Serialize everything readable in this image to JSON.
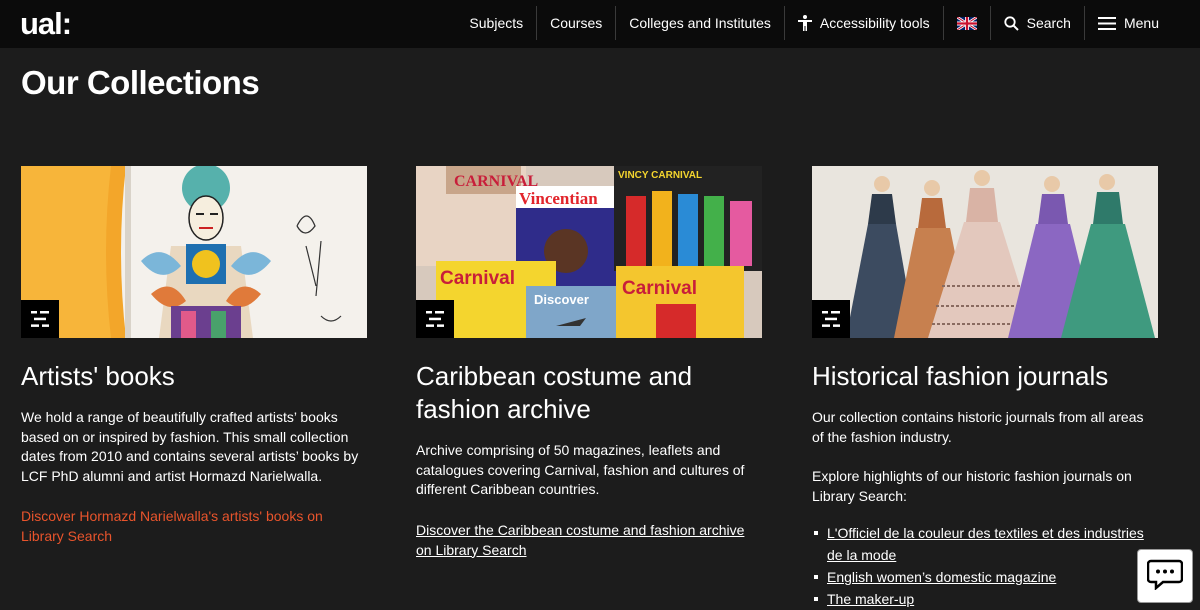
{
  "header": {
    "logo": "ual:",
    "nav": [
      {
        "label": "Subjects"
      },
      {
        "label": "Courses"
      },
      {
        "label": "Colleges and Institutes"
      },
      {
        "label": "Accessibility tools",
        "icon": "accessibility-icon"
      },
      {
        "label": "",
        "icon": "uk-flag-icon"
      },
      {
        "label": "Search",
        "icon": "search-icon"
      },
      {
        "label": "Menu",
        "icon": "hamburger-icon"
      }
    ]
  },
  "page": {
    "title": "Our Collections"
  },
  "cards": [
    {
      "title": "Artists' books",
      "paragraphs": [
        "We hold a range of beautifully crafted artists’ books based on or inspired by fashion. This small collection dates from 2010 and contains several artists’ books by LCF PhD alumni and artist Hormazd Narielwalla."
      ],
      "link": "Discover Hormazd Narielwalla's artists' books on Library Search",
      "link_color": "#e8542c"
    },
    {
      "title": "Caribbean costume and fashion archive",
      "paragraphs": [
        "Archive comprising of 50 magazines, leaflets and catalogues covering Carnival, fashion and cultures of different Caribbean countries."
      ],
      "link": "Discover the Caribbean costume and fashion archive on Library Search"
    },
    {
      "title": "Historical fashion journals",
      "paragraphs": [
        "Our collection contains historic journals from all areas of the fashion industry.",
        "Explore highlights of our historic fashion journals on Library Search:"
      ],
      "list": [
        "L'Officiel de la couleur des textiles et des industries de la mode",
        "English women’s domestic magazine",
        "The maker-up"
      ]
    }
  ],
  "images": {
    "magazine_texts": [
      "CARNIVAL",
      "Vincentian",
      "VINCY CARNIVAL",
      "Carnival",
      "Discover",
      "Carnival"
    ]
  },
  "chat": {
    "icon": "chat-icon"
  },
  "colors": {
    "background": "#1c1c1c",
    "header": "#0b0b0b",
    "accent_link": "#e8542c"
  }
}
